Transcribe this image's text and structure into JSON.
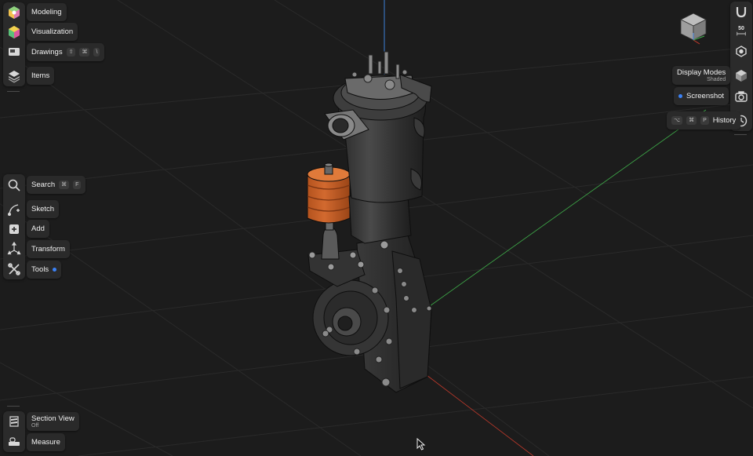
{
  "colors": {
    "background": "#1c1c1c",
    "accent": "#3b82f6",
    "part_highlight": "#d2692f",
    "axis_red": "#c0392b",
    "axis_green": "#3fae4a",
    "axis_blue": "#3d7fd9"
  },
  "left_toolbar_top": [
    {
      "label": "Modeling",
      "icon": "modeling-cube-icon"
    },
    {
      "label": "Visualization",
      "icon": "visualization-cube-icon"
    },
    {
      "label": "Drawings",
      "icon": "drawings-icon",
      "shortcut": [
        "⇧",
        "⌘",
        "\\"
      ]
    },
    {
      "label": "Items",
      "icon": "layers-icon"
    }
  ],
  "left_toolbar_mid": [
    {
      "label": "Search",
      "icon": "search-icon",
      "shortcut": [
        "⌘",
        "F"
      ]
    },
    {
      "label": "Sketch",
      "icon": "sketch-icon"
    },
    {
      "label": "Add",
      "icon": "add-icon"
    },
    {
      "label": "Transform",
      "icon": "transform-icon"
    },
    {
      "label": "Tools",
      "icon": "tools-icon",
      "badge": true
    }
  ],
  "left_toolbar_bottom": [
    {
      "label": "Section View",
      "sub": "Off",
      "icon": "section-view-icon"
    },
    {
      "label": "Measure",
      "icon": "measure-icon"
    }
  ],
  "right_toolbar": {
    "snap_icon": "magnet-icon",
    "zoom_value": "50",
    "zoom_icon": "zoom-mm-icon",
    "orbit_icon": "orbit-icon",
    "display_modes": {
      "label": "Display Modes",
      "sub": "Shaded",
      "icon": "shaded-cube-icon"
    },
    "screenshot": {
      "label": "Screenshot",
      "icon": "camera-icon",
      "badge": true
    },
    "history": {
      "label": "History",
      "icon": "clock-icon",
      "shortcut": [
        "⌥",
        "⌘",
        "P"
      ]
    }
  },
  "view_cube": {
    "icon": "view-cube-icon"
  }
}
